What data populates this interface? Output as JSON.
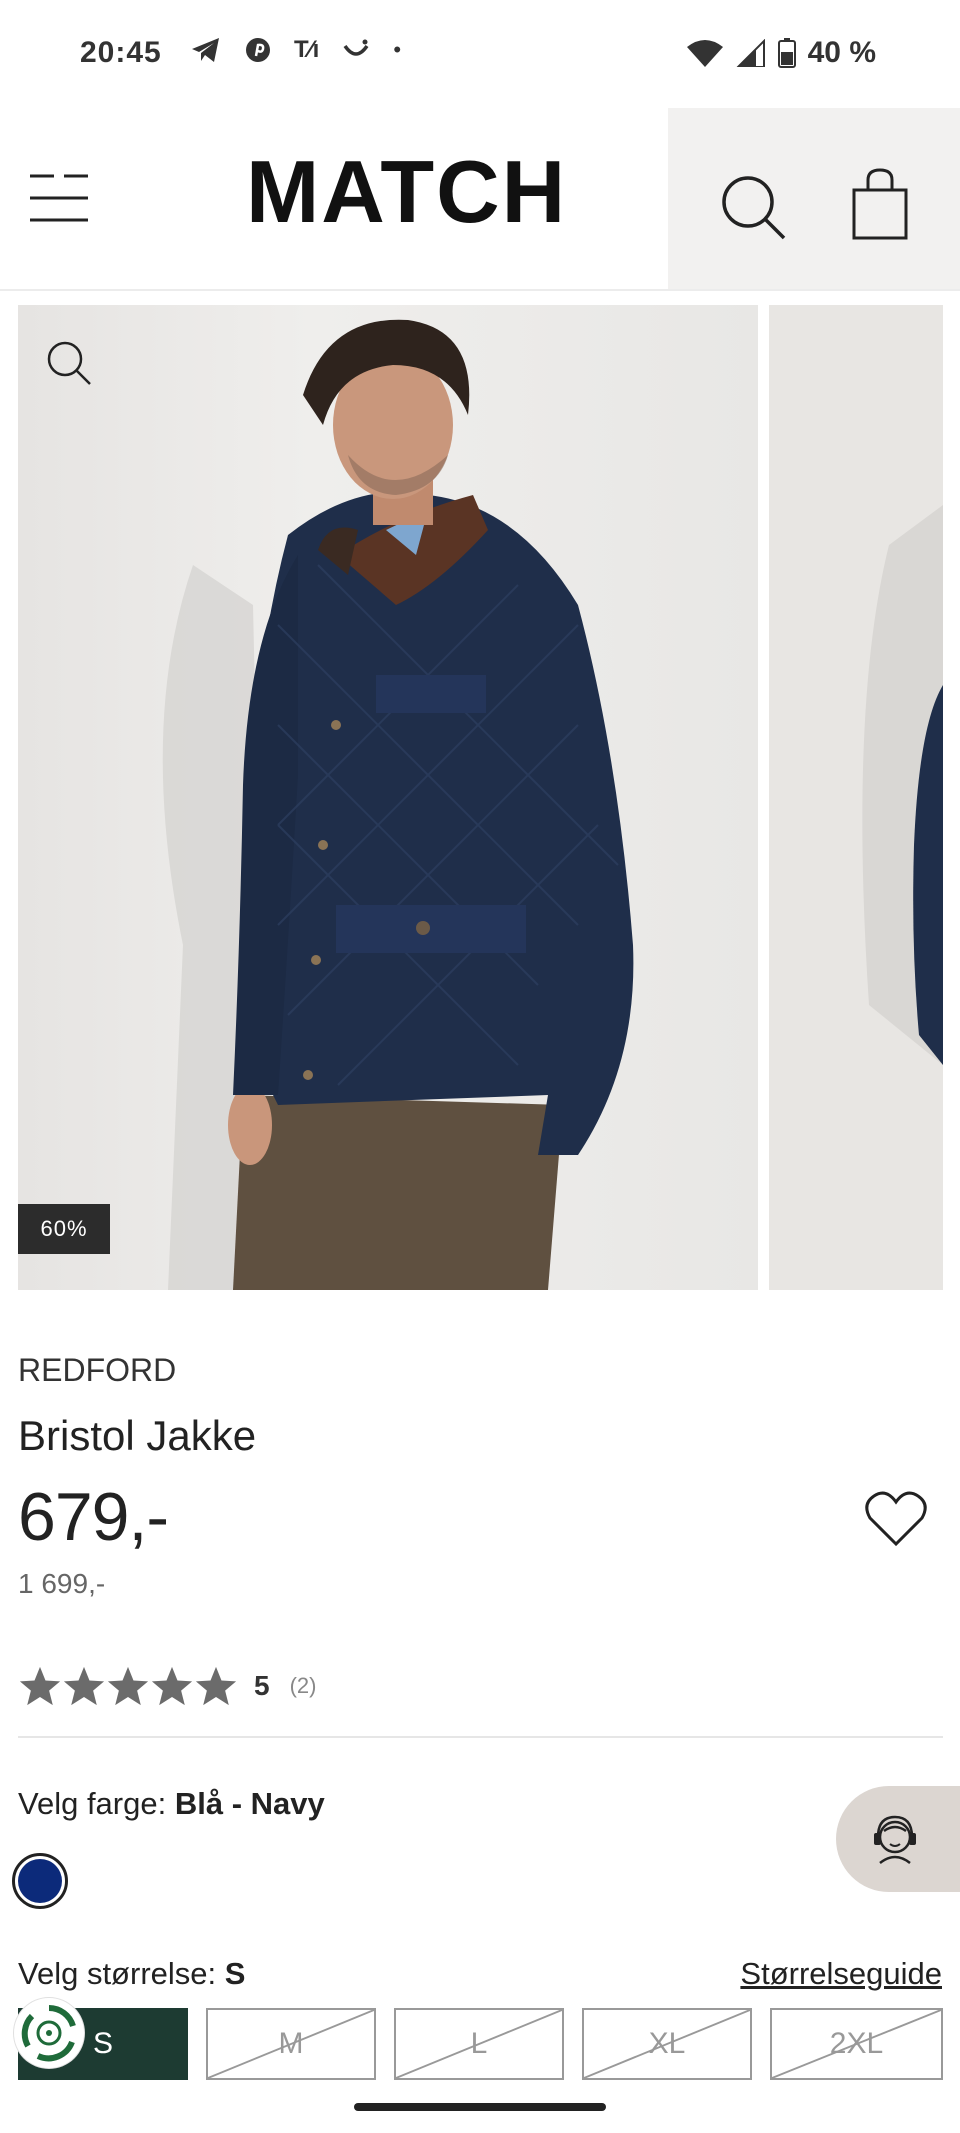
{
  "status_bar": {
    "time": "20:45",
    "battery": "40 %"
  },
  "header": {
    "logo": "MATCH"
  },
  "gallery": {
    "discount_badge": "60%"
  },
  "product": {
    "brand": "REDFORD",
    "title": "Bristol Jakke",
    "price": "679,-",
    "old_price": "1 699,-",
    "rating": {
      "value": 5,
      "display": "5",
      "count": "(2)"
    }
  },
  "color": {
    "label": "Velg farge:",
    "selected": "Blå - Navy",
    "swatch_hex": "#0c2a7a"
  },
  "size": {
    "label": "Velg størrelse:",
    "selected": "S",
    "guide_link": "Størrelseguide",
    "options": [
      "S",
      "M",
      "L",
      "XL",
      "2XL"
    ]
  },
  "colors": {
    "accent": "#1d3b32",
    "badge": "#2c2c2c",
    "chat_bg": "#dcd6d1"
  }
}
